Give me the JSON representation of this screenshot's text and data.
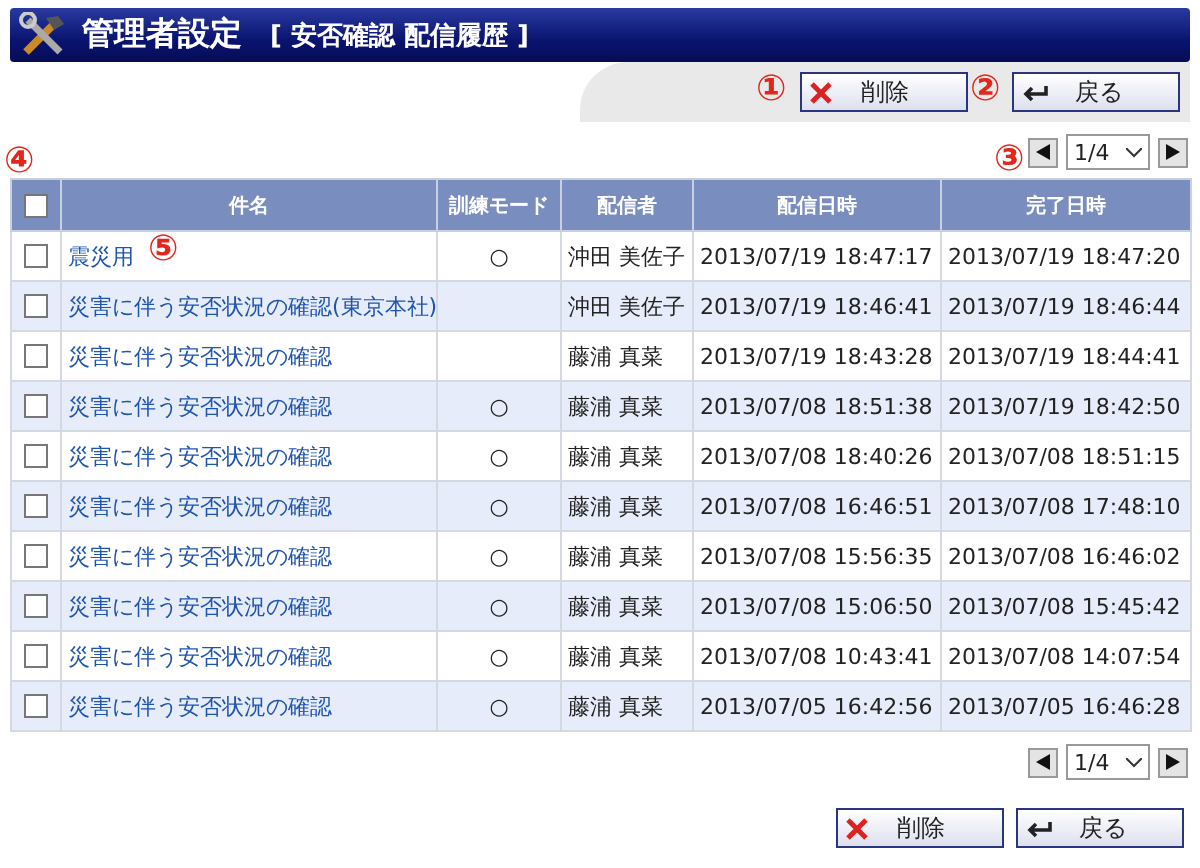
{
  "header": {
    "title": "管理者設定",
    "subtitle": "[ 安否確認 配信履歴 ]"
  },
  "toolbar": {
    "buttons": [
      {
        "kind": "delete",
        "label": "削除"
      },
      {
        "kind": "back",
        "label": "戻る"
      }
    ]
  },
  "pager_top": {
    "page": "1/4"
  },
  "table": {
    "header_checkbox": {
      "checked": false
    },
    "columns": [
      "件名",
      "訓練モード",
      "配信者",
      "配信日時",
      "完了日時"
    ],
    "rows": [
      {
        "checked": false,
        "subject": "震災用",
        "training_mode": "○",
        "sender": "沖田 美佐子",
        "sent": "2013/07/19 18:47:17",
        "completed": "2013/07/19 18:47:20"
      },
      {
        "checked": false,
        "subject": "災害に伴う安否状況の確認(東京本社)",
        "sender": "沖田 美佐子",
        "sent": "2013/07/19 18:46:41",
        "completed": "2013/07/19 18:46:44"
      },
      {
        "checked": false,
        "subject": "災害に伴う安否状況の確認",
        "sender": "藤浦 真菜",
        "sent": "2013/07/19 18:43:28",
        "completed": "2013/07/19 18:44:41"
      },
      {
        "checked": false,
        "subject": "災害に伴う安否状況の確認",
        "training_mode": "○",
        "sender": "藤浦 真菜",
        "sent": "2013/07/08 18:51:38",
        "completed": "2013/07/19 18:42:50"
      },
      {
        "checked": false,
        "subject": "災害に伴う安否状況の確認",
        "training_mode": "○",
        "sender": "藤浦 真菜",
        "sent": "2013/07/08 18:40:26",
        "completed": "2013/07/08 18:51:15"
      },
      {
        "checked": false,
        "subject": "災害に伴う安否状況の確認",
        "training_mode": "○",
        "sender": "藤浦 真菜",
        "sent": "2013/07/08 16:46:51",
        "completed": "2013/07/08 17:48:10"
      },
      {
        "checked": false,
        "subject": "災害に伴う安否状況の確認",
        "training_mode": "○",
        "sender": "藤浦 真菜",
        "sent": "2013/07/08 15:56:35",
        "completed": "2013/07/08 16:46:02"
      },
      {
        "checked": false,
        "subject": "災害に伴う安否状況の確認",
        "training_mode": "○",
        "sender": "藤浦 真菜",
        "sent": "2013/07/08 15:06:50",
        "completed": "2013/07/08 15:45:42"
      },
      {
        "checked": false,
        "subject": "災害に伴う安否状況の確認",
        "training_mode": "○",
        "sender": "藤浦 真菜",
        "sent": "2013/07/08 10:43:41",
        "completed": "2013/07/08 14:07:54"
      },
      {
        "checked": false,
        "subject": "災害に伴う安否状況の確認",
        "training_mode": "○",
        "sender": "藤浦 真菜",
        "sent": "2013/07/05 16:42:56",
        "completed": "2013/07/05 16:46:28"
      }
    ]
  },
  "pager_bottom": {
    "page": "1/4"
  },
  "footer": {
    "buttons": [
      {
        "kind": "delete",
        "label": "削除"
      },
      {
        "kind": "back",
        "label": "戻る"
      }
    ]
  },
  "annotations": [
    "①",
    "②",
    "③",
    "④",
    "⑤"
  ]
}
